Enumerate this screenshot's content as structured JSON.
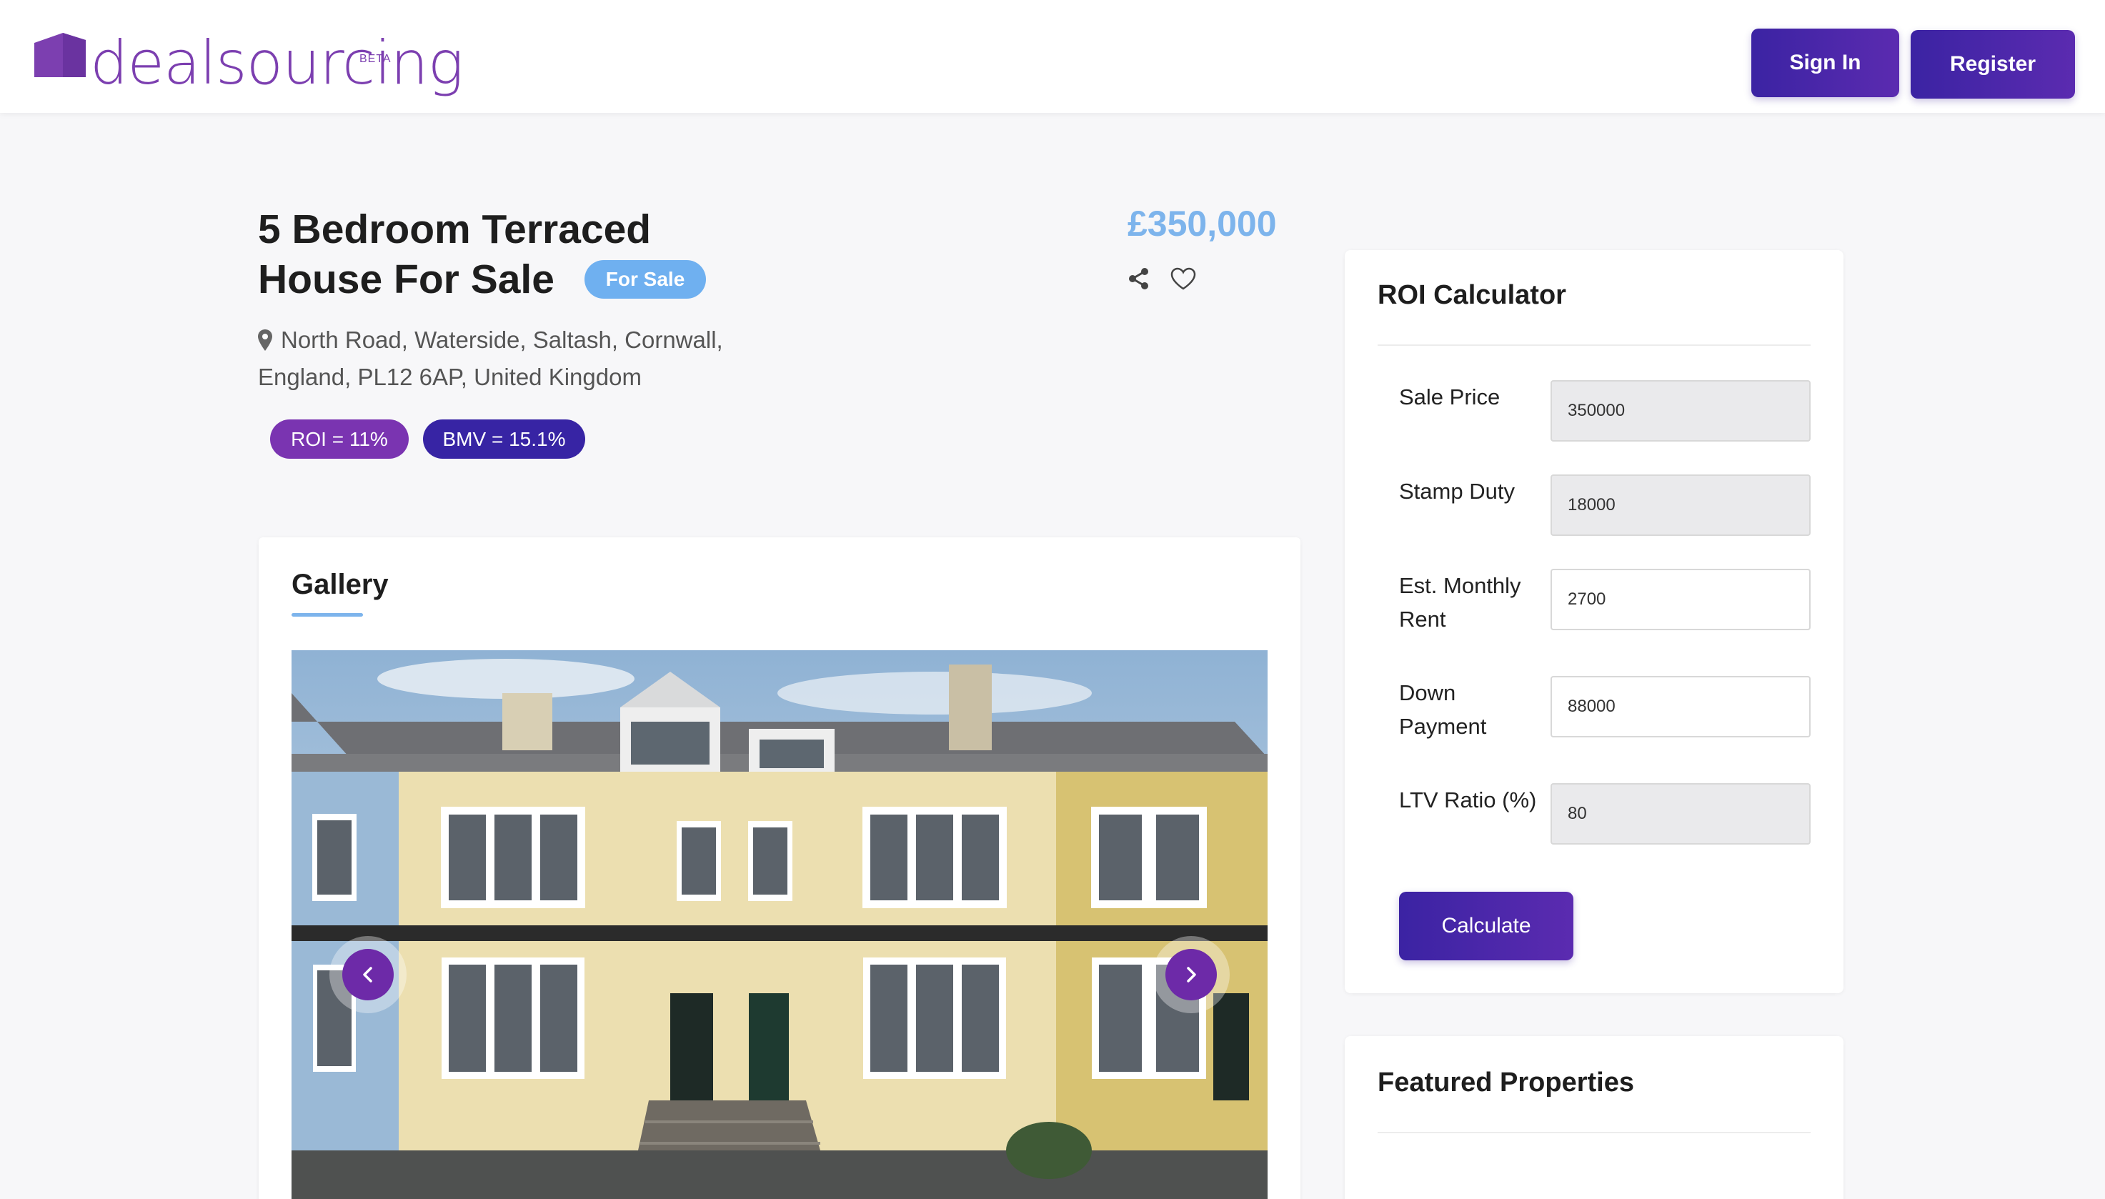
{
  "header": {
    "logo_text": "dealsourcing",
    "logo_beta": "BETA",
    "sign_in_label": "Sign In",
    "register_label": "Register"
  },
  "listing": {
    "title": "5 Bedroom Terraced House For Sale",
    "status_badge": "For Sale",
    "address": "North Road, Waterside, Saltash, Cornwall, England, PL12 6AP, United Kingdom",
    "price": "£350,000",
    "roi_pill": "ROI = 11%",
    "bmv_pill": "BMV = 15.1%",
    "icons": [
      "share-icon",
      "heart-icon",
      "map-pin-icon"
    ]
  },
  "gallery": {
    "title": "Gallery",
    "prev_icon": "chevron-left-icon",
    "next_icon": "chevron-right-icon"
  },
  "roi_calculator": {
    "title": "ROI Calculator",
    "fields": [
      {
        "label": "Sale Price",
        "value": "350000",
        "readonly": true
      },
      {
        "label": "Stamp Duty",
        "value": "18000",
        "readonly": true
      },
      {
        "label": "Est. Monthly Rent",
        "value": "2700",
        "readonly": false
      },
      {
        "label": "Down Payment",
        "value": "88000",
        "readonly": false
      },
      {
        "label": "LTV Ratio (%)",
        "value": "80",
        "readonly": true
      }
    ],
    "calculate_label": "Calculate"
  },
  "featured": {
    "title": "Featured Properties"
  },
  "colors": {
    "brand_purple": "#7c3fb0",
    "button_gradient_start": "#3b23a3",
    "button_gradient_end": "#5b2bb0",
    "price_blue": "#7db4ec",
    "sale_badge": "#6fb0f0",
    "roi_pill": "#7a34b1",
    "bmv_pill": "#3724a4"
  }
}
